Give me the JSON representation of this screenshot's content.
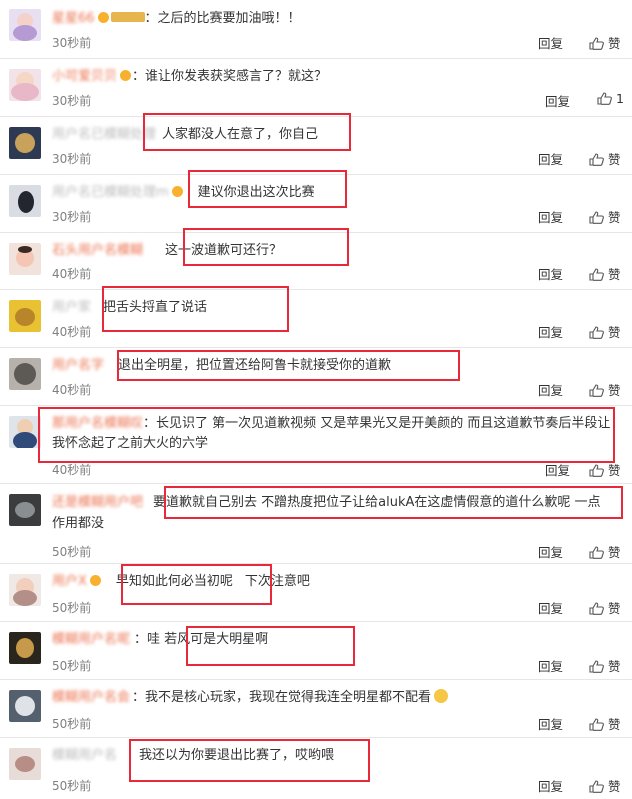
{
  "comments": [
    {
      "user": "星星66",
      "text": "：之后的比赛要加油哦！！",
      "time": "30秒前",
      "reply": "回复",
      "like": "赞",
      "badge": true,
      "medal": true
    },
    {
      "user": "小可爱贝贝",
      "text": "：谁让你发表获奖感言了？就这？",
      "time": "30秒前",
      "reply": "回复",
      "like": "1",
      "badge": true
    },
    {
      "user": "用户名已模糊处理",
      "text": "人家都没人在意了，你自己",
      "time": "30秒前",
      "reply": "回复",
      "like": "赞"
    },
    {
      "user": "用户名已模糊处理m",
      "text": "建议你退出这次比赛",
      "time": "30秒前",
      "reply": "回复",
      "like": "赞",
      "badge": true
    },
    {
      "user": "石头用户名模糊",
      "text": "这一波道歉可还行？",
      "time": "40秒前",
      "reply": "回复",
      "like": "赞"
    },
    {
      "user": "用户家",
      "text": "把舌头捋直了说话",
      "time": "40秒前",
      "reply": "回复",
      "like": "赞"
    },
    {
      "user": "用户名字",
      "text": "退出全明星，把位置还给阿鲁卡就接受你的道歉",
      "time": "40秒前",
      "reply": "回复",
      "like": "赞"
    },
    {
      "user": "那用户名模糊叹",
      "text": "：长见识了  第一次见道歉视频 又是苹果光又是开美颜的 而且这道歉节奏后半段让我怀念起了之前大火的六学",
      "time": "40秒前",
      "reply": "回复",
      "like": "赞"
    },
    {
      "user": "还是模糊用户吧",
      "text": "要道歉就自己别去 不蹭热度把位子让给alukA在这虚情假意的道什么歉呢 一点作用都没",
      "time": "50秒前",
      "reply": "回复",
      "like": "赞"
    },
    {
      "user": "用户X",
      "text": "早知如此何必当初呢",
      "extra": "下次注意吧",
      "time": "50秒前",
      "reply": "回复",
      "like": "赞",
      "badge": true
    },
    {
      "user": "模糊用户名呢",
      "text": "：哇 若风可是大明星啊",
      "time": "50秒前",
      "reply": "回复",
      "like": "赞"
    },
    {
      "user": "模糊用户名会",
      "text": "：我不是核心玩家，我现在觉得我连全明星都不配看",
      "time": "50秒前",
      "reply": "回复",
      "like": "赞"
    },
    {
      "user": "模糊用户名",
      "text": "我还以为你要退出比赛了，哎哟喂",
      "time": "50秒前",
      "reply": "回复",
      "like": "赞"
    }
  ],
  "colors": {
    "username": "#eb7350",
    "highlight": "#e8293a",
    "time": "#808080"
  }
}
